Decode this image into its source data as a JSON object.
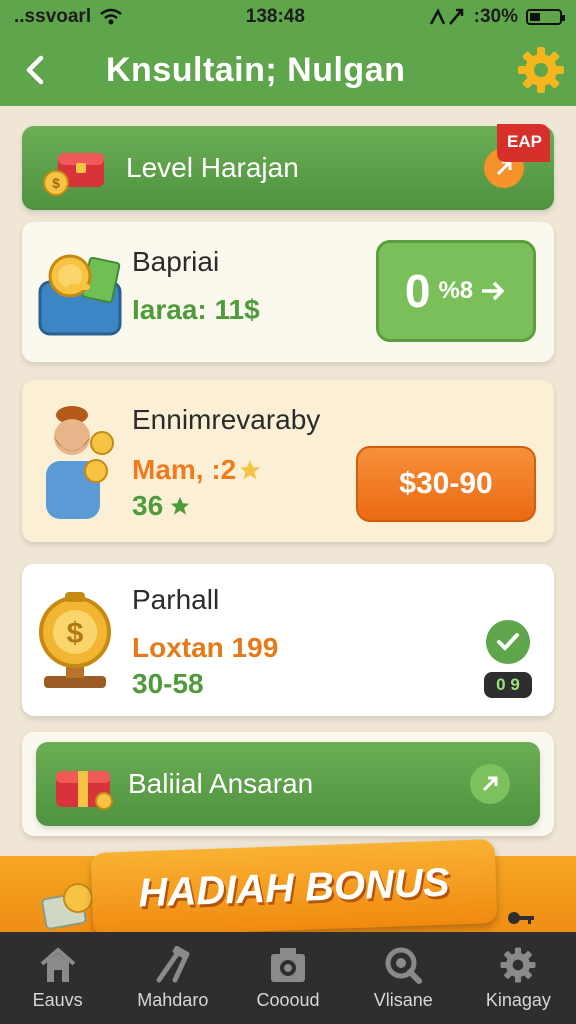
{
  "status_bar": {
    "carrier": "..ssvoarl",
    "time": "138:48",
    "battery_text": ":30%"
  },
  "header": {
    "title": "Knsultain; Nulgan",
    "back_icon": "chevron-left-icon",
    "settings_icon": "gear-icon"
  },
  "top_banner": {
    "label": "Level Harajan",
    "badge": "EAP",
    "icon": "treasure-chest-icon",
    "arrow_icon": "arrow-right-icon"
  },
  "cards": [
    {
      "title": "Bapriai",
      "line1": "Iaraa: 11$",
      "button_number": "0",
      "button_text": "%8",
      "icon": "money-suitcase-icon",
      "button_color": "#7bbf5a"
    },
    {
      "title": "Ennimrevaraby",
      "line1": "Mam, :2",
      "line2": "36",
      "button_text": "$30-90",
      "icon": "man-with-coins-icon",
      "button_color": "#f07a1e"
    },
    {
      "title": "Parhall",
      "line1": "Loxtan 199",
      "line2": "30-58",
      "check_badge": "0 9",
      "icon": "gold-coin-trophy-icon"
    }
  ],
  "bottom_banner": {
    "label": "Baliial Ansaran",
    "icon": "gift-box-icon",
    "arrow_icon": "arrow-right-icon"
  },
  "bonus": {
    "label": "HADIAH BONUS",
    "icon": "cash-stack-icon"
  },
  "bottom_nav": [
    {
      "label": "Eauvs",
      "icon": "home-icon"
    },
    {
      "label": "Mahdaro",
      "icon": "tools-icon"
    },
    {
      "label": "Coooud",
      "icon": "camera-icon"
    },
    {
      "label": "Vlisane",
      "icon": "search-icon"
    },
    {
      "label": "Kinagay",
      "icon": "gear-icon"
    }
  ],
  "colors": {
    "primary_green": "#5fa54c",
    "accent_orange": "#f07a1e",
    "card_bg": "#fbf8ee",
    "nav_bg": "#2e2e2e"
  }
}
